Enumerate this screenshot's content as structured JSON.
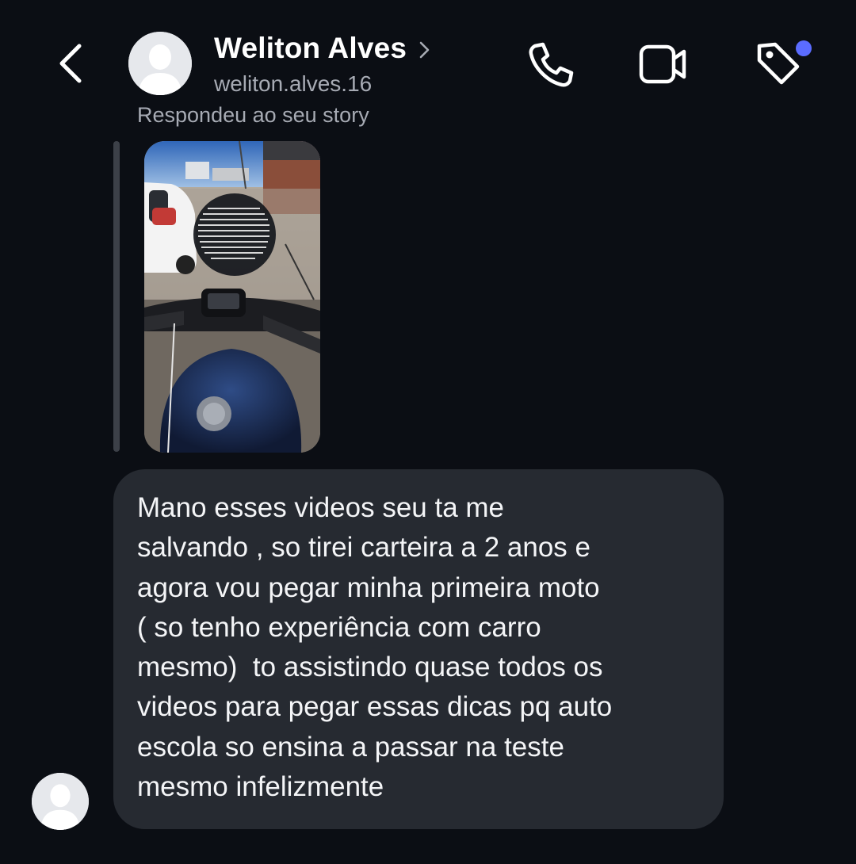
{
  "header": {
    "contact_name": "Weliton Alves",
    "username": "weliton.alves.16",
    "reply_note": "Respondeu ao seu story",
    "icons": {
      "back": "back-arrow-icon",
      "name_chevron": "chevron-right-icon",
      "call": "phone-icon",
      "video": "video-camera-icon",
      "tag": "tag-icon"
    },
    "notification_dot_color": "#5b6cff"
  },
  "story_reply": {
    "thumbnail_icon": "story-video-thumbnail"
  },
  "message": {
    "lines": [
      "Mano esses videos seu ta me",
      "salvando , so tirei carteira a 2 anos e",
      "agora vou pegar minha primeira moto",
      "( so tenho experiência com carro",
      "mesmo)  to assistindo quase todos os",
      "videos para pegar essas dicas pq auto",
      "escola so ensina a passar na teste",
      "mesmo infelizmente"
    ]
  },
  "colors": {
    "background": "#0b0e14",
    "bubble": "#262a31",
    "secondary_text": "#a7abb4"
  }
}
